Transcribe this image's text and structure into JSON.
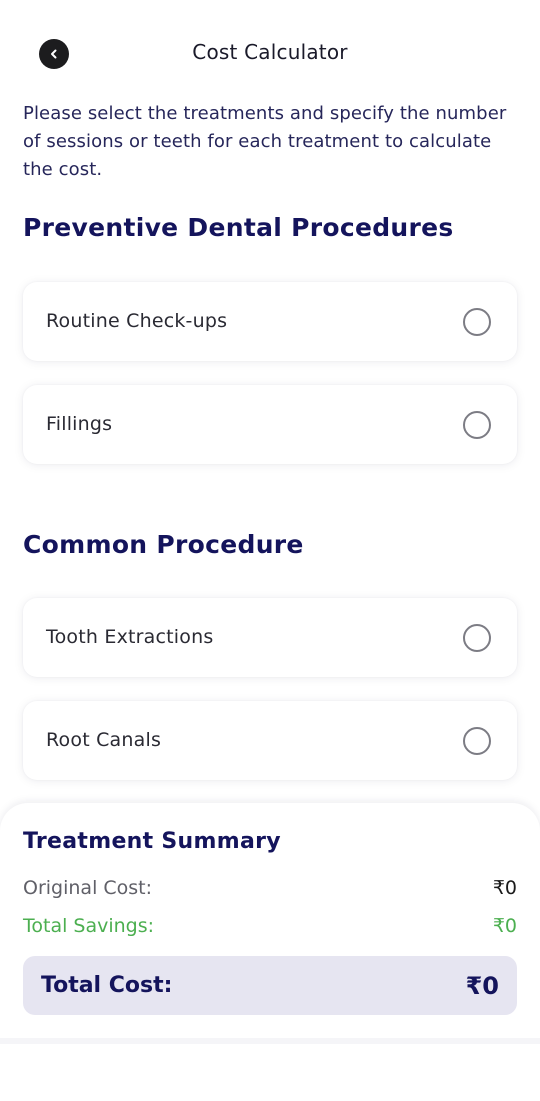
{
  "header": {
    "title": "Cost Calculator",
    "back_icon": "chevron-left-icon"
  },
  "intro_text": "Please select the treatments and specify the number of sessions or teeth for each treatment to calculate the cost.",
  "sections": [
    {
      "title": "Preventive Dental Procedures",
      "items": [
        {
          "label": "Routine Check-ups",
          "selected": false
        },
        {
          "label": "Fillings",
          "selected": false
        }
      ]
    },
    {
      "title": "Common Procedure",
      "items": [
        {
          "label": "Tooth Extractions",
          "selected": false
        },
        {
          "label": "Root Canals",
          "selected": false
        }
      ]
    }
  ],
  "summary": {
    "title": "Treatment Summary",
    "original_cost_label": "Original Cost:",
    "original_cost_value": "₹0",
    "total_savings_label": "Total Savings:",
    "total_savings_value": "₹0",
    "total_cost_label": "Total Cost:",
    "total_cost_value": "₹0"
  },
  "colors": {
    "heading": "#14145c",
    "savings": "#4caf50",
    "total_box": "#e6e5f1"
  }
}
